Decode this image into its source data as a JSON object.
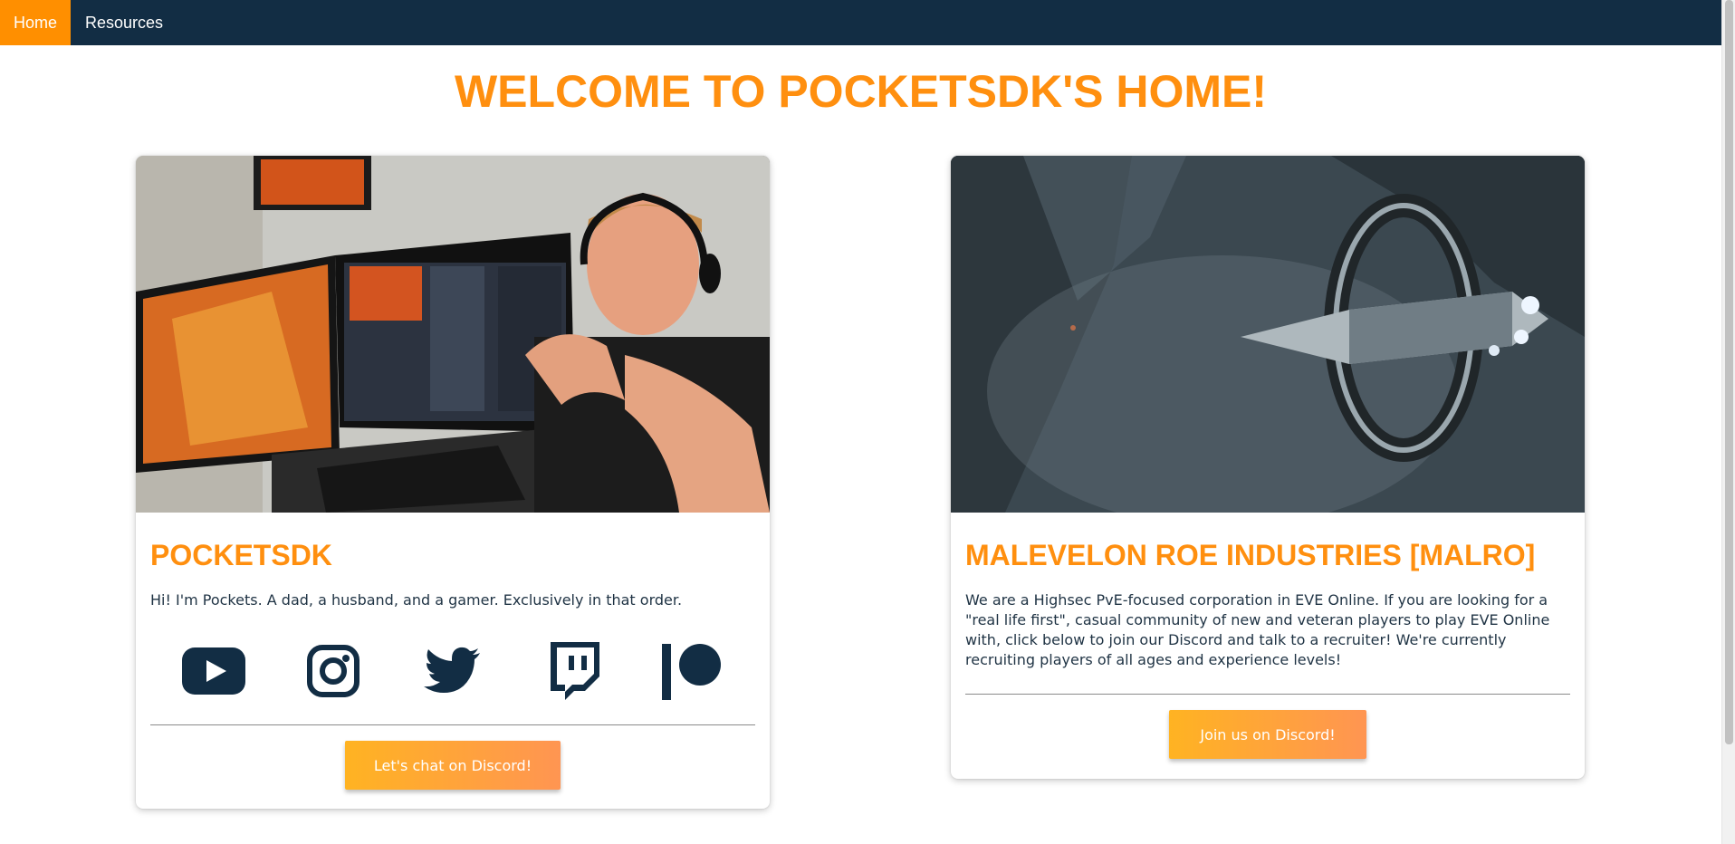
{
  "nav": {
    "items": [
      {
        "label": "Home",
        "active": true
      },
      {
        "label": "Resources",
        "active": false
      }
    ]
  },
  "page": {
    "title": "WELCOME TO POCKETSDK'S HOME!"
  },
  "cards": [
    {
      "title": "POCKETSDK",
      "text": "Hi! I'm Pockets. A dad, a husband, and a gamer. Exclusively in that order.",
      "social_icons": [
        "youtube-icon",
        "instagram-icon",
        "twitter-icon",
        "twitch-icon",
        "patreon-icon"
      ],
      "button_label": "Let's chat on Discord!"
    },
    {
      "title": "MALEVELON ROE INDUSTRIES [MALRO]",
      "text": "We are a Highsec PvE-focused corporation in EVE Online. If you are looking for a \"real life first\", casual community of new and veteran players to play EVE Online with, click below to join our Discord and talk to a recruiter! We're currently recruiting players of all ages and experience levels!",
      "button_label": "Join us on Discord!"
    }
  ],
  "colors": {
    "nav_bg": "#122d44",
    "accent": "#ff8f0f",
    "icon": "#122d44"
  }
}
